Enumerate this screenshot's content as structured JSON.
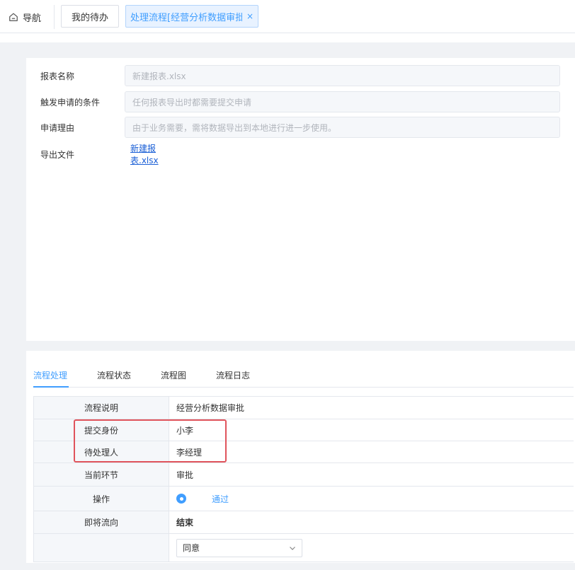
{
  "topbar": {
    "home_label": "导航",
    "tab_todo": "我的待办",
    "tab_active": "处理流程[经营分析数据审批]",
    "tab_close": "×"
  },
  "form": {
    "report_name": {
      "label": "报表名称",
      "value": "新建报表.xlsx"
    },
    "trigger": {
      "label": "触发申请的条件",
      "value": "任何报表导出时都需要提交申请"
    },
    "reason": {
      "label": "申请理由",
      "value": "由于业务需要，需将数据导出到本地进行进一步使用。"
    },
    "export_file": {
      "label": "导出文件",
      "link": "新建报表.xlsx"
    }
  },
  "flow_tabs": [
    "流程处理",
    "流程状态",
    "流程图",
    "流程日志"
  ],
  "table": {
    "rows": [
      {
        "key": "流程说明",
        "value": "经营分析数据审批"
      },
      {
        "key": "提交身份",
        "value": "小李"
      },
      {
        "key": "待处理人",
        "value": "李经理"
      },
      {
        "key": "当前环节",
        "value": "审批"
      },
      {
        "key": "操作",
        "value": "通过"
      },
      {
        "key": "即将流向",
        "value": "结束"
      },
      {
        "key": "",
        "value": "同意"
      }
    ]
  },
  "colors": {
    "accent": "#409eff",
    "highlight": "#e0545c",
    "link": "#1a5fd6"
  }
}
